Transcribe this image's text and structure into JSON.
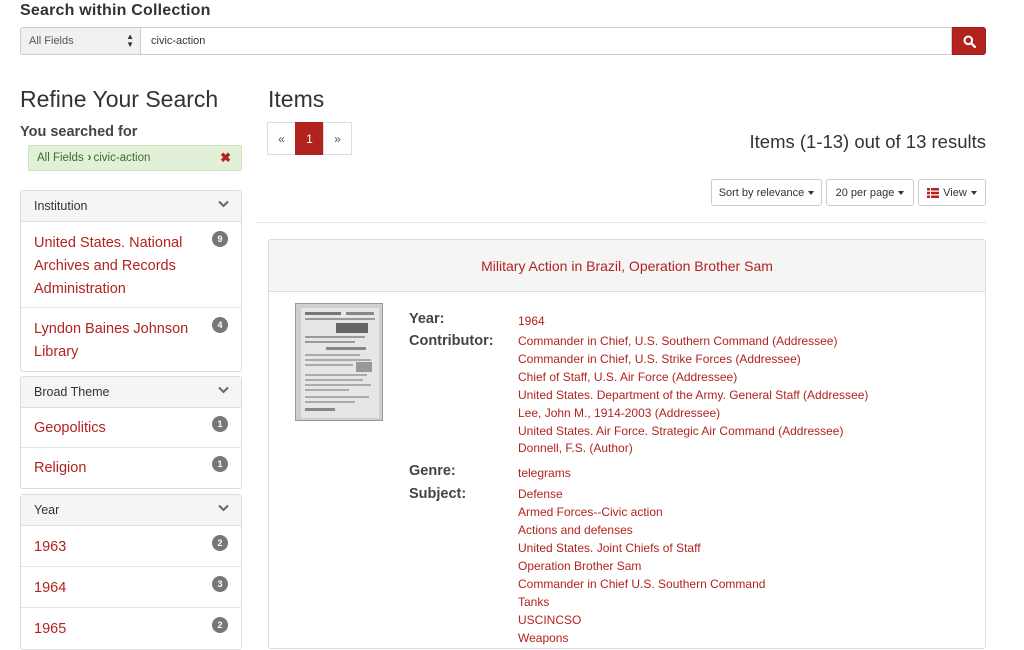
{
  "search": {
    "heading": "Search within Collection",
    "field": "All Fields",
    "query": "civic-action"
  },
  "sidebar": {
    "title": "Refine Your Search",
    "searched_for": "You searched for",
    "constraint": {
      "field": "All Fields",
      "value": "civic-action"
    },
    "facets": [
      {
        "title": "Institution",
        "items": [
          {
            "label": "United States. National Archives and Records Administration",
            "count": "9"
          },
          {
            "label": "Lyndon Baines Johnson Library",
            "count": "4"
          }
        ]
      },
      {
        "title": "Broad Theme",
        "items": [
          {
            "label": "Geopolitics",
            "count": "1"
          },
          {
            "label": "Religion",
            "count": "1"
          }
        ]
      },
      {
        "title": "Year",
        "items": [
          {
            "label": "1963",
            "count": "2"
          },
          {
            "label": "1964",
            "count": "3"
          },
          {
            "label": "1965",
            "count": "2"
          }
        ]
      }
    ]
  },
  "main": {
    "title": "Items",
    "pagination": {
      "prev": "«",
      "current": "1",
      "next": "»"
    },
    "results_count": "Items (1-13) out of 13 results",
    "sort_label": "Sort by relevance",
    "per_page_label": "20 per page",
    "view_label": "View"
  },
  "result": {
    "title": "Military Action in Brazil, Operation Brother Sam",
    "year_label": "Year:",
    "year": "1964",
    "contributor_label": "Contributor:",
    "contributors": [
      "Commander in Chief, U.S. Southern Command (Addressee)",
      "Commander in Chief, U.S. Strike Forces (Addressee)",
      "Chief of Staff, U.S. Air Force (Addressee)",
      "United States. Department of the Army. General Staff (Addressee)",
      "Lee, John M., 1914-2003 (Addressee)",
      "United States. Air Force. Strategic Air Command (Addressee)",
      "Donnell, F.S. (Author)"
    ],
    "genre_label": "Genre:",
    "genre": "telegrams",
    "subject_label": "Subject:",
    "subjects": [
      "Defense",
      "Armed Forces--Civic action",
      "Actions and defenses",
      "United States. Joint Chiefs of Staff",
      "Operation Brother Sam",
      "Commander in Chief U.S. Southern Command",
      "Tanks",
      "USCINCSO",
      "Weapons"
    ]
  },
  "colors": {
    "accent": "#b2231f",
    "constraint_bg": "#e3f0d8",
    "badge": "#777777"
  },
  "icons": {
    "search": "search-icon",
    "remove": "close-icon",
    "chevron": "chevron-down-icon",
    "view": "list-icon"
  }
}
